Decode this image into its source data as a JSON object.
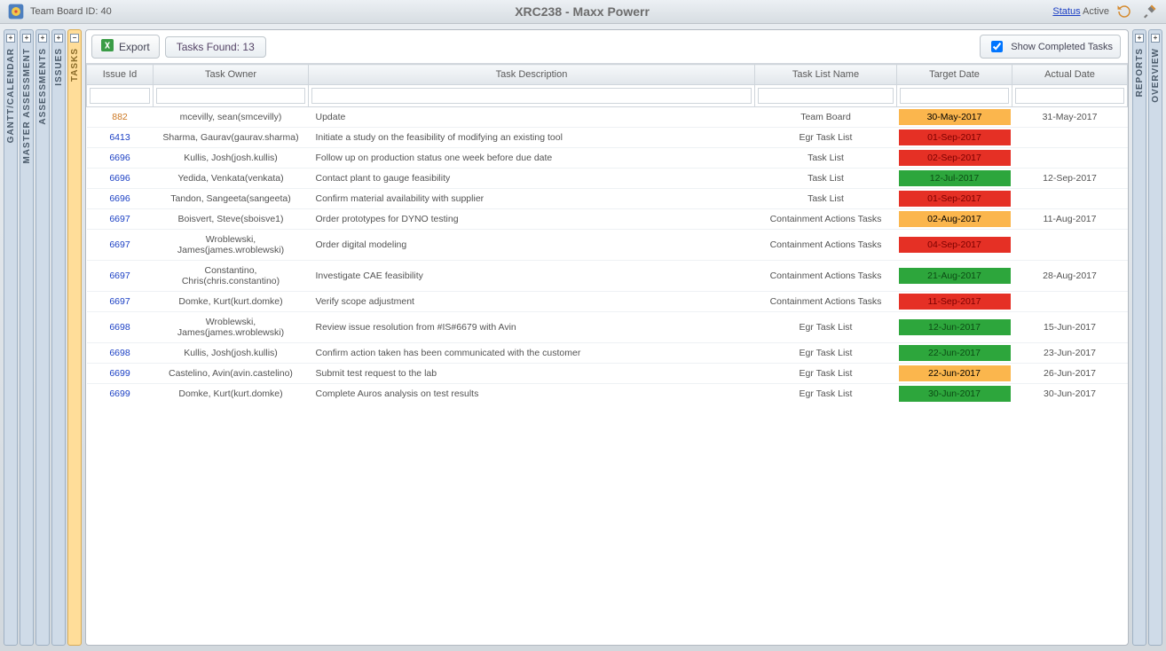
{
  "header": {
    "board_id_label": "Team Board ID: 40",
    "title": "XRC238 - Maxx Powerr",
    "status_link": "Status",
    "status_value": "Active"
  },
  "left_tabs": [
    {
      "label": "GANTT/CALENDAR",
      "toggle": "+"
    },
    {
      "label": "MASTER ASSESSMENT",
      "toggle": "+"
    },
    {
      "label": "ASSESSMENTS",
      "toggle": "+"
    },
    {
      "label": "ISSUES",
      "toggle": "+"
    },
    {
      "label": "TASKS",
      "toggle": "−",
      "active": true
    }
  ],
  "right_tabs": [
    {
      "label": "REPORTS",
      "toggle": "+"
    },
    {
      "label": "OVERVIEW",
      "toggle": "+"
    }
  ],
  "toolbar": {
    "export_label": "Export",
    "tasks_found_label": "Tasks Found: 13",
    "checkbox_label": "Show Completed Tasks"
  },
  "columns": {
    "issue_id": "Issue Id",
    "task_owner": "Task Owner",
    "task_desc": "Task Description",
    "list_name": "Task List Name",
    "target": "Target Date",
    "actual": "Actual Date"
  },
  "rows": [
    {
      "id": "882",
      "id_link": false,
      "owner": "mcevilly, sean(smcevilly)",
      "desc": "Update",
      "list": "Team Board",
      "target": "30-May-2017",
      "tclass": "orange",
      "actual": "31-May-2017"
    },
    {
      "id": "6413",
      "id_link": true,
      "owner": "Sharma, Gaurav(gaurav.sharma)",
      "desc": "Initiate a study on the feasibility of modifying an existing tool",
      "list": "Egr Task List",
      "target": "01-Sep-2017",
      "tclass": "red",
      "actual": ""
    },
    {
      "id": "6696",
      "id_link": true,
      "owner": "Kullis, Josh(josh.kullis)",
      "desc": "Follow up on production status one week before due date",
      "list": "Task List",
      "target": "02-Sep-2017",
      "tclass": "red",
      "actual": ""
    },
    {
      "id": "6696",
      "id_link": true,
      "owner": "Yedida, Venkata(venkata)",
      "desc": "Contact plant to gauge feasibility",
      "list": "Task List",
      "target": "12-Jul-2017",
      "tclass": "green",
      "actual": "12-Sep-2017"
    },
    {
      "id": "6696",
      "id_link": true,
      "owner": "Tandon, Sangeeta(sangeeta)",
      "desc": "Confirm material availability with supplier",
      "list": "Task List",
      "target": "01-Sep-2017",
      "tclass": "red",
      "actual": ""
    },
    {
      "id": "6697",
      "id_link": true,
      "owner": "Boisvert, Steve(sboisve1)",
      "desc": "Order prototypes for DYNO testing",
      "list": "Containment Actions Tasks",
      "target": "02-Aug-2017",
      "tclass": "orange",
      "actual": "11-Aug-2017"
    },
    {
      "id": "6697",
      "id_link": true,
      "owner": "Wroblewski, James(james.wroblewski)",
      "desc": "Order digital modeling",
      "list": "Containment Actions Tasks",
      "target": "04-Sep-2017",
      "tclass": "red",
      "actual": ""
    },
    {
      "id": "6697",
      "id_link": true,
      "owner": "Constantino, Chris(chris.constantino)",
      "desc": "Investigate CAE feasibility",
      "list": "Containment Actions Tasks",
      "target": "21-Aug-2017",
      "tclass": "green",
      "actual": "28-Aug-2017"
    },
    {
      "id": "6697",
      "id_link": true,
      "owner": "Domke, Kurt(kurt.domke)",
      "desc": "Verify scope adjustment",
      "list": "Containment Actions Tasks",
      "target": "11-Sep-2017",
      "tclass": "red",
      "actual": ""
    },
    {
      "id": "6698",
      "id_link": true,
      "owner": "Wroblewski, James(james.wroblewski)",
      "desc": "Review issue resolution from #IS#6679 with Avin",
      "list": "Egr Task List",
      "target": "12-Jun-2017",
      "tclass": "green",
      "actual": "15-Jun-2017"
    },
    {
      "id": "6698",
      "id_link": true,
      "owner": "Kullis, Josh(josh.kullis)",
      "desc": "Confirm action taken has been communicated with the customer",
      "list": "Egr Task List",
      "target": "22-Jun-2017",
      "tclass": "green",
      "actual": "23-Jun-2017"
    },
    {
      "id": "6699",
      "id_link": true,
      "owner": "Castelino, Avin(avin.castelino)",
      "desc": "Submit test request to the lab",
      "list": "Egr Task List",
      "target": "22-Jun-2017",
      "tclass": "orange",
      "actual": "26-Jun-2017"
    },
    {
      "id": "6699",
      "id_link": true,
      "owner": "Domke, Kurt(kurt.domke)",
      "desc": "Complete Auros analysis on test results",
      "list": "Egr Task List",
      "target": "30-Jun-2017",
      "tclass": "green",
      "actual": "30-Jun-2017"
    }
  ]
}
